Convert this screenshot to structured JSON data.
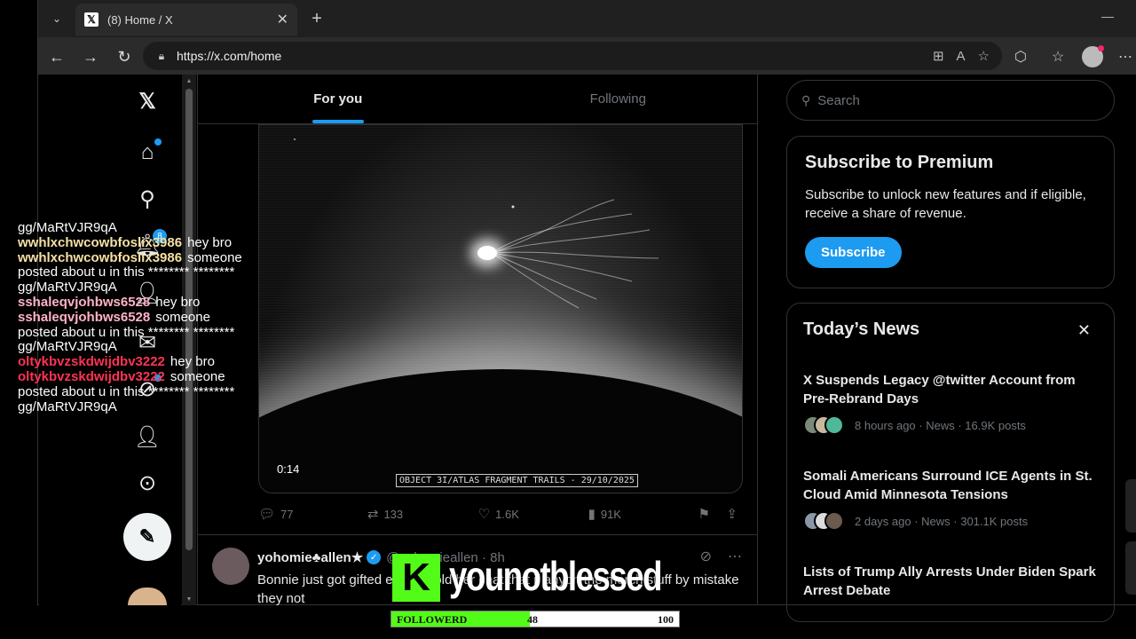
{
  "browser": {
    "tab_title": "(8) Home / X",
    "url": "https://x.com/home",
    "favicon_letter": "𝕏"
  },
  "x": {
    "logo": "𝕏",
    "notification_count": "8",
    "post_button_icon": "✎",
    "feed_tabs": [
      "For you",
      "Following"
    ],
    "video": {
      "time": "0:14",
      "caption": "OBJECT 3I/ATLAS FRAGMENT TRAILS - 29/10/2025"
    },
    "actions": {
      "replies": "77",
      "reposts": "133",
      "likes": "1.6K",
      "views": "91K"
    },
    "tweet2": {
      "name": "yohomie♣allen★",
      "handle": "@yohomieallen · 8h",
      "text": "Bonnie just got gifted er then told her chat that if anyon the merch stuff by mistake they not"
    },
    "search_placeholder": "Search",
    "premium": {
      "title": "Subscribe to Premium",
      "description": "Subscribe to unlock new features and if eligible, receive a share of revenue.",
      "button": "Subscribe"
    },
    "news": {
      "title": "Today’s News",
      "items": [
        {
          "headline": "X Suspends Legacy @twitter Account from Pre-Rebrand Days",
          "meta": "8 hours ago · News · 16.9K posts"
        },
        {
          "headline": "Somali Americans Surround ICE Agents in St. Cloud Amid Minnesota Tensions",
          "meta": "2 days ago · News · 301.1K posts"
        },
        {
          "headline": "Lists of Trump Ally Arrests Under Biden Spark Arrest Debate",
          "meta": ""
        }
      ]
    }
  },
  "chat": {
    "lines": [
      {
        "user": "",
        "text": "gg/MaRtVJR9qA"
      },
      {
        "user": "wwhlxchwcowbfoslix3986",
        "text": "hey bro"
      },
      {
        "user": "wwhlxchwcowbfoslix3986",
        "text": "someone"
      },
      {
        "user": "",
        "text": "posted about u in this ******** ********"
      },
      {
        "user": "",
        "text": "gg/MaRtVJR9qA"
      },
      {
        "user": "sshaleqvjohbws6528",
        "text": "hey bro"
      },
      {
        "user": "sshaleqvjohbws6528",
        "text": "someone"
      },
      {
        "user": "",
        "text": "posted about u in this ******** ********"
      },
      {
        "user": "",
        "text": "gg/MaRtVJR9qA"
      },
      {
        "user": "oltykbvzskdwijdbv3222",
        "text": "hey bro"
      },
      {
        "user": "oltykbvzskdwijdbv3222",
        "text": "someone"
      },
      {
        "user": "",
        "text": "posted about u in this ******** ********"
      },
      {
        "user": "",
        "text": "gg/MaRtVJR9qA"
      }
    ],
    "colors": {
      "u1": "#f5e1a4",
      "u2": "#ffb3c7",
      "u3": "#ff3355"
    }
  },
  "stream": {
    "channel": "younotblessed",
    "goal_label": "FOLLOWERD",
    "goal_current": "48",
    "goal_max": "100",
    "goal_fraction": 0.48,
    "accent": "#53fc18"
  }
}
